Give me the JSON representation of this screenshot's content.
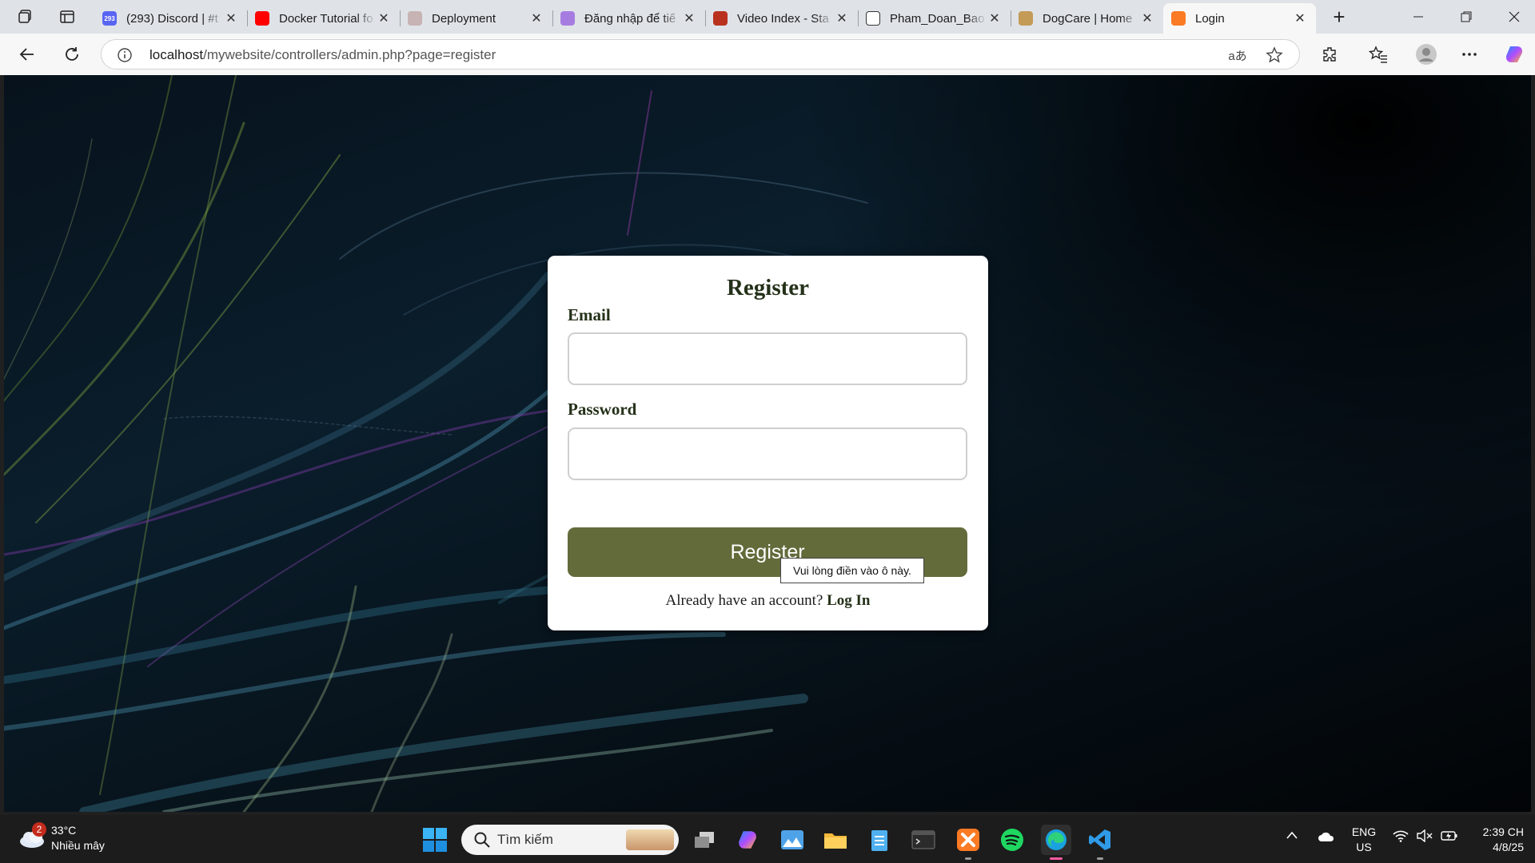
{
  "browser": {
    "tabs": [
      {
        "title": "(293) Discord | #t",
        "favicon": "discord-icon",
        "color": "#5865f2",
        "badge": "293",
        "active": false
      },
      {
        "title": "Docker Tutorial fo",
        "favicon": "youtube-icon",
        "color": "#ff0000",
        "active": false
      },
      {
        "title": "Deployment",
        "favicon": "deployment-icon",
        "color": "#c7b3b3",
        "active": false
      },
      {
        "title": "Đăng nhập để tiế",
        "favicon": "u-icon",
        "color": "#a77ce0",
        "active": false
      },
      {
        "title": "Video Index - Sta",
        "favicon": "video-index-icon",
        "color": "#b8321e",
        "active": false
      },
      {
        "title": "Pham_Doan_Bao",
        "favicon": "github-icon",
        "color": "#ffffff",
        "active": false
      },
      {
        "title": "DogCare | Home",
        "favicon": "dog-icon",
        "color": "#c49a57",
        "active": false
      },
      {
        "title": "Login",
        "favicon": "xampp-icon",
        "color": "#fb7a24",
        "active": true
      }
    ],
    "url_host": "localhost",
    "url_path": "/mywebsite/controllers/admin.php?page=register"
  },
  "form": {
    "title": "Register",
    "email_label": "Email",
    "email_value": "",
    "password_label": "Password",
    "password_value": "",
    "submit_label": "Register",
    "login_prompt": "Already have an account?",
    "login_link": "Log In",
    "validation_tooltip": "Vui lòng điền vào ô này.",
    "button_color": "#646b3b",
    "heading_color": "#243119"
  },
  "taskbar": {
    "weather_badge": "2",
    "weather_temp": "33°C",
    "weather_desc": "Nhiều mây",
    "search_placeholder": "Tìm kiếm",
    "lang_line1": "ENG",
    "lang_line2": "US",
    "time": "2:39 CH",
    "date": "4/8/25"
  }
}
